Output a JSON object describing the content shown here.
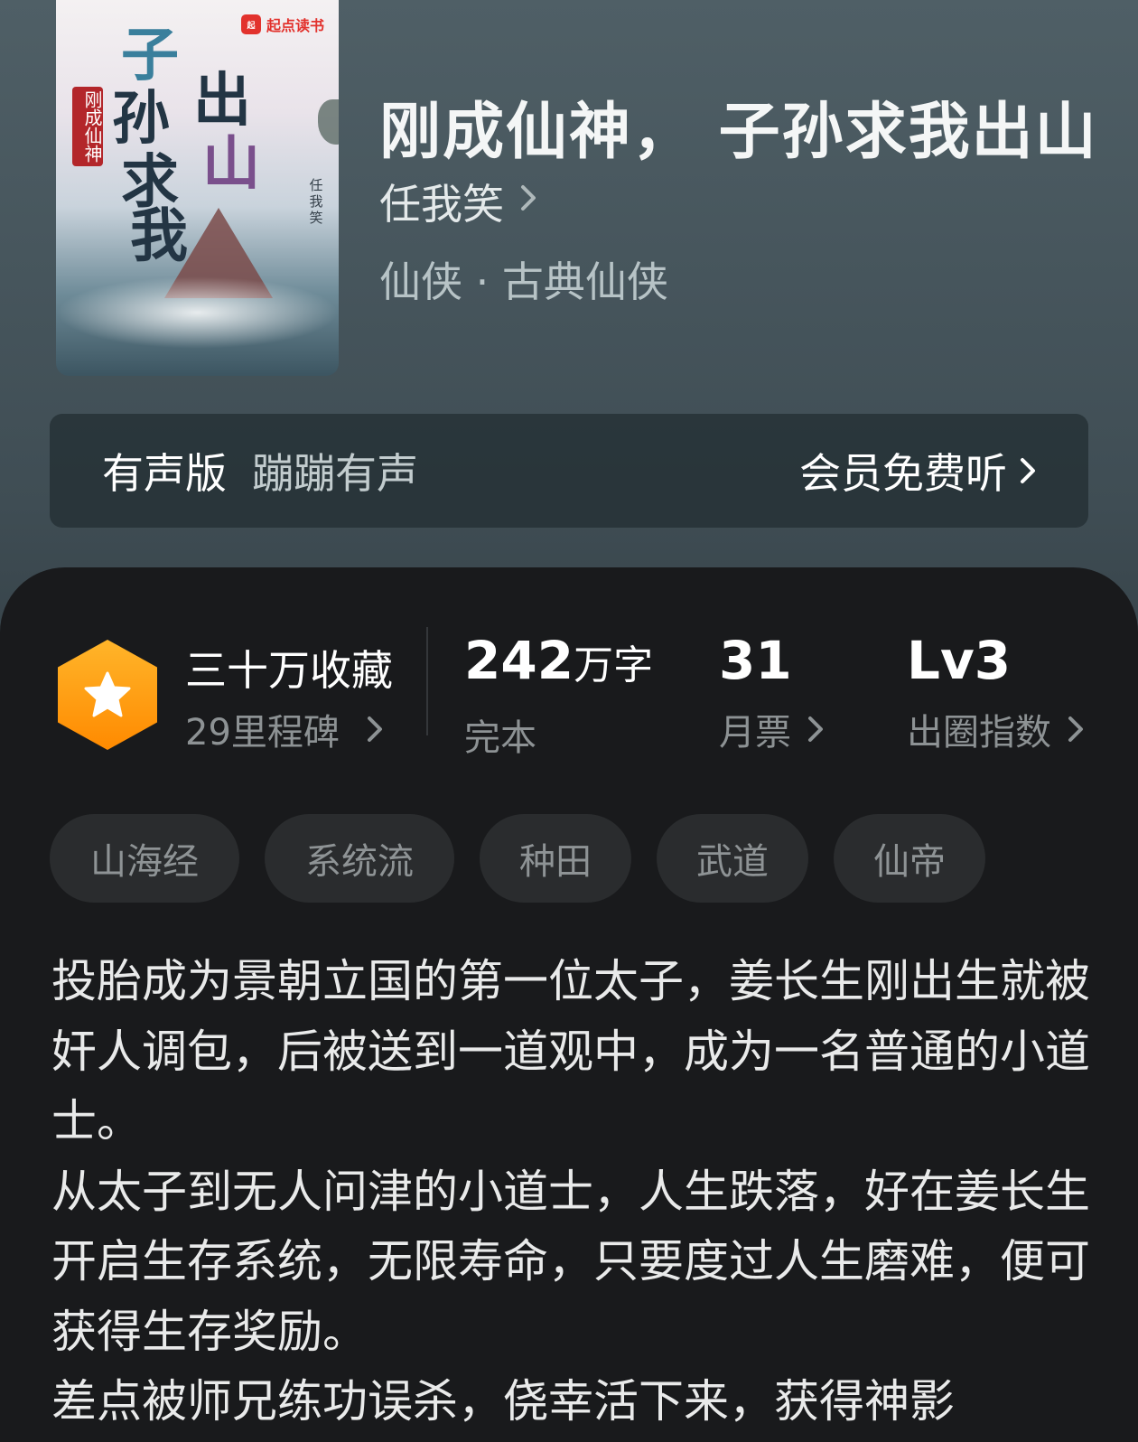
{
  "cover": {
    "brand": "起点读书",
    "title_chars": [
      "子",
      "孙",
      "求",
      "我",
      "出",
      "山"
    ],
    "subtitle": "刚成仙神",
    "author_vertical": "任我笑"
  },
  "book": {
    "title": "刚成仙神，  子孙求我出山",
    "author": "任我笑",
    "genre": "仙侠 · 古典仙侠"
  },
  "audio": {
    "label": "有声版",
    "source": "蹦蹦有声",
    "cta": "会员免费听"
  },
  "stats": {
    "favorites": "三十万收藏",
    "milestones": "29里程碑",
    "words_value": "242",
    "words_unit": "万字",
    "status": "完本",
    "monthly_value": "31",
    "monthly_label": "月票",
    "level_value": "Lv3",
    "level_label": "出圈指数"
  },
  "tags": [
    "山海经",
    "系统流",
    "种田",
    "武道",
    "仙帝"
  ],
  "description": [
    "投胎成为景朝立国的第一位太子，姜长生刚出生就被奸人调包，后被送到一道观中，成为一名普通的小道士。",
    "从太子到无人问津的小道士，人生跌落，好在姜长生开启生存系统，无限寿命，只要度过人生磨难，便可获得生存奖励。",
    "差点被师兄练功误杀，侥幸活下来，获得神影"
  ],
  "colors": {
    "accent": "#ff9d14",
    "panel": "#191a1c",
    "tag_bg": "#2a2c2e"
  }
}
